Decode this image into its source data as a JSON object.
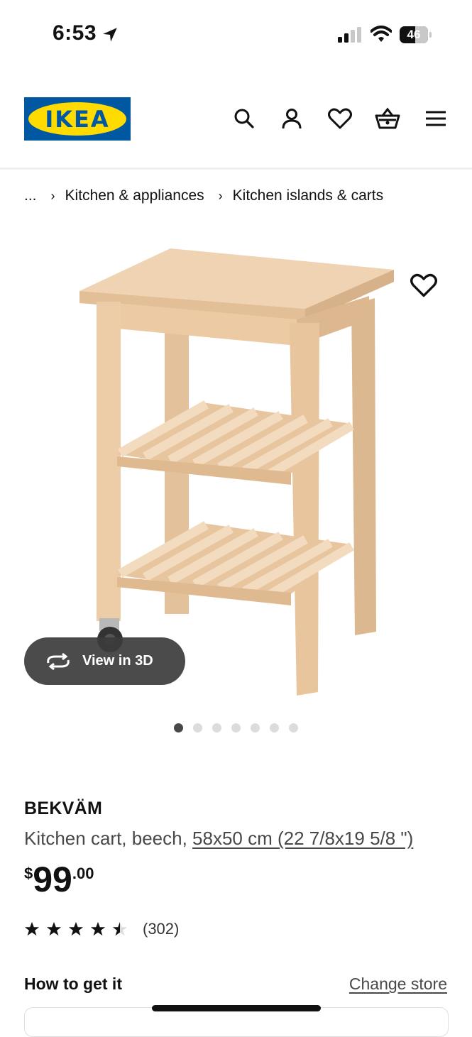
{
  "status_bar": {
    "time": "6:53",
    "battery": "46"
  },
  "header": {
    "logo_text": "IKEA",
    "icons": [
      "search-icon",
      "account-icon",
      "favorites-icon",
      "cart-icon",
      "menu-icon"
    ]
  },
  "breadcrumb": {
    "ellipsis": "...",
    "items": [
      "Kitchen & appliances",
      "Kitchen islands & carts"
    ]
  },
  "gallery": {
    "view_3d_label": "View in 3D",
    "dot_count": 7,
    "active_dot": 1
  },
  "product": {
    "name": "BEKVÄM",
    "description": "Kitchen cart, beech, ",
    "dimensions": "58x50 cm (22 7/8x19 5/8 \")",
    "price": {
      "currency": "$",
      "integer": "99",
      "decimal": ".00"
    },
    "rating": {
      "stars": 4.5,
      "count": "(302)"
    }
  },
  "availability": {
    "title": "How to get it",
    "change_store_label": "Change store"
  },
  "colors": {
    "ikea_blue": "#0058a3",
    "ikea_yellow": "#ffdb00",
    "wood": "#e9c9a4"
  }
}
